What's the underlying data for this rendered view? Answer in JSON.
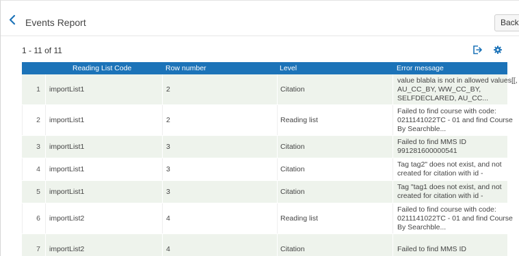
{
  "header": {
    "title": "Events Report",
    "back_label": "Back"
  },
  "toolbar": {
    "count": "1 - 11 of 11",
    "export_icon": "export-icon",
    "settings_icon": "gear-icon"
  },
  "colors": {
    "accent": "#1c73b8",
    "row_alt": "#eef3ec"
  },
  "table": {
    "columns": [
      "Reading List Code",
      "Row number",
      "Level",
      "Error message"
    ],
    "rows": [
      {
        "num": "1",
        "code": "importList1",
        "row": "2",
        "level": "Citation",
        "error": [
          "value blabla is not in allowed values[[,",
          "AU_CC_BY, WW_CC_BY,",
          "SELFDECLARED, AU_CC..."
        ]
      },
      {
        "num": "2",
        "code": "importList1",
        "row": "2",
        "level": "Reading list",
        "error": [
          "Failed to find course with code:",
          "0211141022TC - 01 and find Course",
          "By Searchble..."
        ]
      },
      {
        "num": "3",
        "code": "importList1",
        "row": "3",
        "level": "Citation",
        "error": [
          "Failed to find MMS ID",
          "991281600000541"
        ]
      },
      {
        "num": "4",
        "code": "importList1",
        "row": "3",
        "level": "Citation",
        "error": [
          "Tag tag2\" does not exist, and not",
          "created for citation with id -"
        ]
      },
      {
        "num": "5",
        "code": "importList1",
        "row": "3",
        "level": "Citation",
        "error": [
          "Tag \"tag1 does not exist, and not",
          "created for citation with id -"
        ]
      },
      {
        "num": "6",
        "code": "importList2",
        "row": "4",
        "level": "Reading list",
        "error": [
          "Failed to find course with code:",
          "0211141022TC - 01 and find Course",
          "By Searchble..."
        ]
      },
      {
        "num": "7",
        "code": "importList2",
        "row": "4",
        "level": "Citation",
        "error": [
          "Failed to find MMS ID",
          ""
        ]
      }
    ]
  }
}
